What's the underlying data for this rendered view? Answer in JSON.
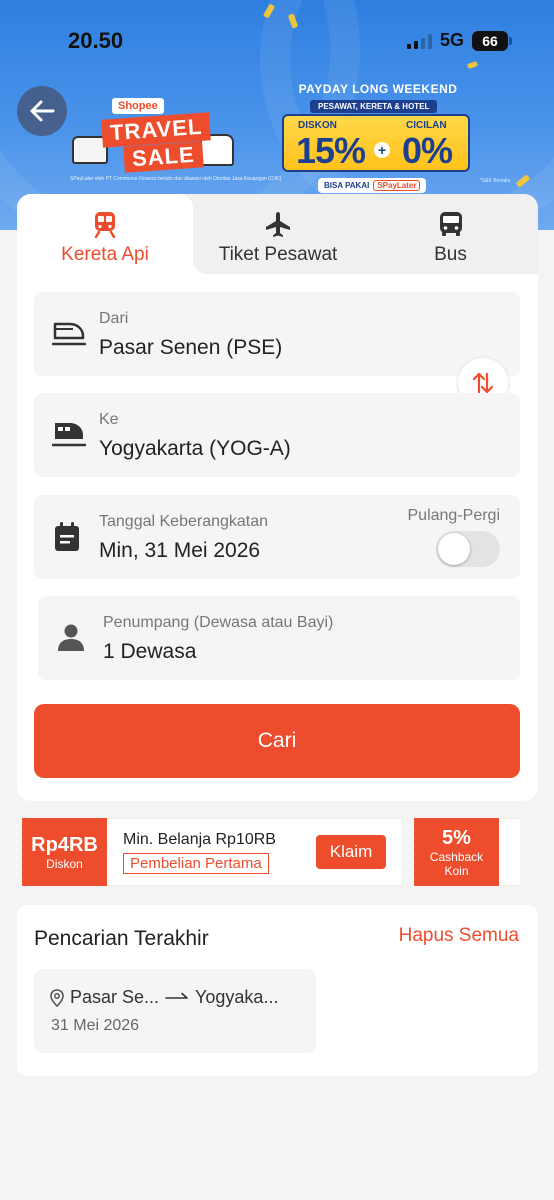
{
  "status_bar": {
    "time": "20.50",
    "network": "5G",
    "battery": "66"
  },
  "banner": {
    "brand": "Shopee",
    "travel": "TRAVEL",
    "sale": "SALE",
    "headline": "PAYDAY LONG WEEKEND",
    "categories": "PESAWAT, KERETA & HOTEL",
    "discount_label": "DISKON",
    "discount_value": "15%",
    "installment_label": "CICILAN",
    "installment_value": "0%",
    "pay_with": "BISA PAKAI",
    "paylater": "SPayLater",
    "fine_print": "SPayLater oleh PT Commerce Finance berizin dan diawasi oleh Otoritas Jasa Keuangan (OJK)",
    "terms": "*S&K Berlaku"
  },
  "tabs": [
    {
      "label": "Kereta Api",
      "icon": "train-icon",
      "active": true
    },
    {
      "label": "Tiket Pesawat",
      "icon": "airplane-icon",
      "active": false
    },
    {
      "label": "Bus",
      "icon": "bus-icon",
      "active": false
    }
  ],
  "form": {
    "from": {
      "label": "Dari",
      "value": "Pasar Senen (PSE)"
    },
    "to": {
      "label": "Ke",
      "value": "Yogyakarta (YOG-A)"
    },
    "date": {
      "label": "Tanggal Keberangkatan",
      "value": "Min, 31 Mei 2026"
    },
    "round_trip": {
      "label": "Pulang-Pergi",
      "enabled": false
    },
    "passengers": {
      "label": "Penumpang (Dewasa atau Bayi)",
      "value": "1 Dewasa"
    },
    "search_button": "Cari"
  },
  "vouchers": [
    {
      "amount": "Rp4RB",
      "type": "Diskon",
      "min_spend": "Min. Belanja Rp10RB",
      "tag": "Pembelian Pertama",
      "claim": "Klaim"
    },
    {
      "amount": "5%",
      "type": "Cashback Koin"
    }
  ],
  "recent": {
    "title": "Pencarian Terakhir",
    "clear_all": "Hapus Semua",
    "items": [
      {
        "from": "Pasar Se...",
        "to": "Yogyaka...",
        "date": "31 Mei 2026"
      }
    ]
  },
  "colors": {
    "accent": "#ee4d2d",
    "banner_blue": "#3a86e6",
    "promo_navy": "#1d3f8f",
    "promo_yellow": "#ffc21a"
  }
}
